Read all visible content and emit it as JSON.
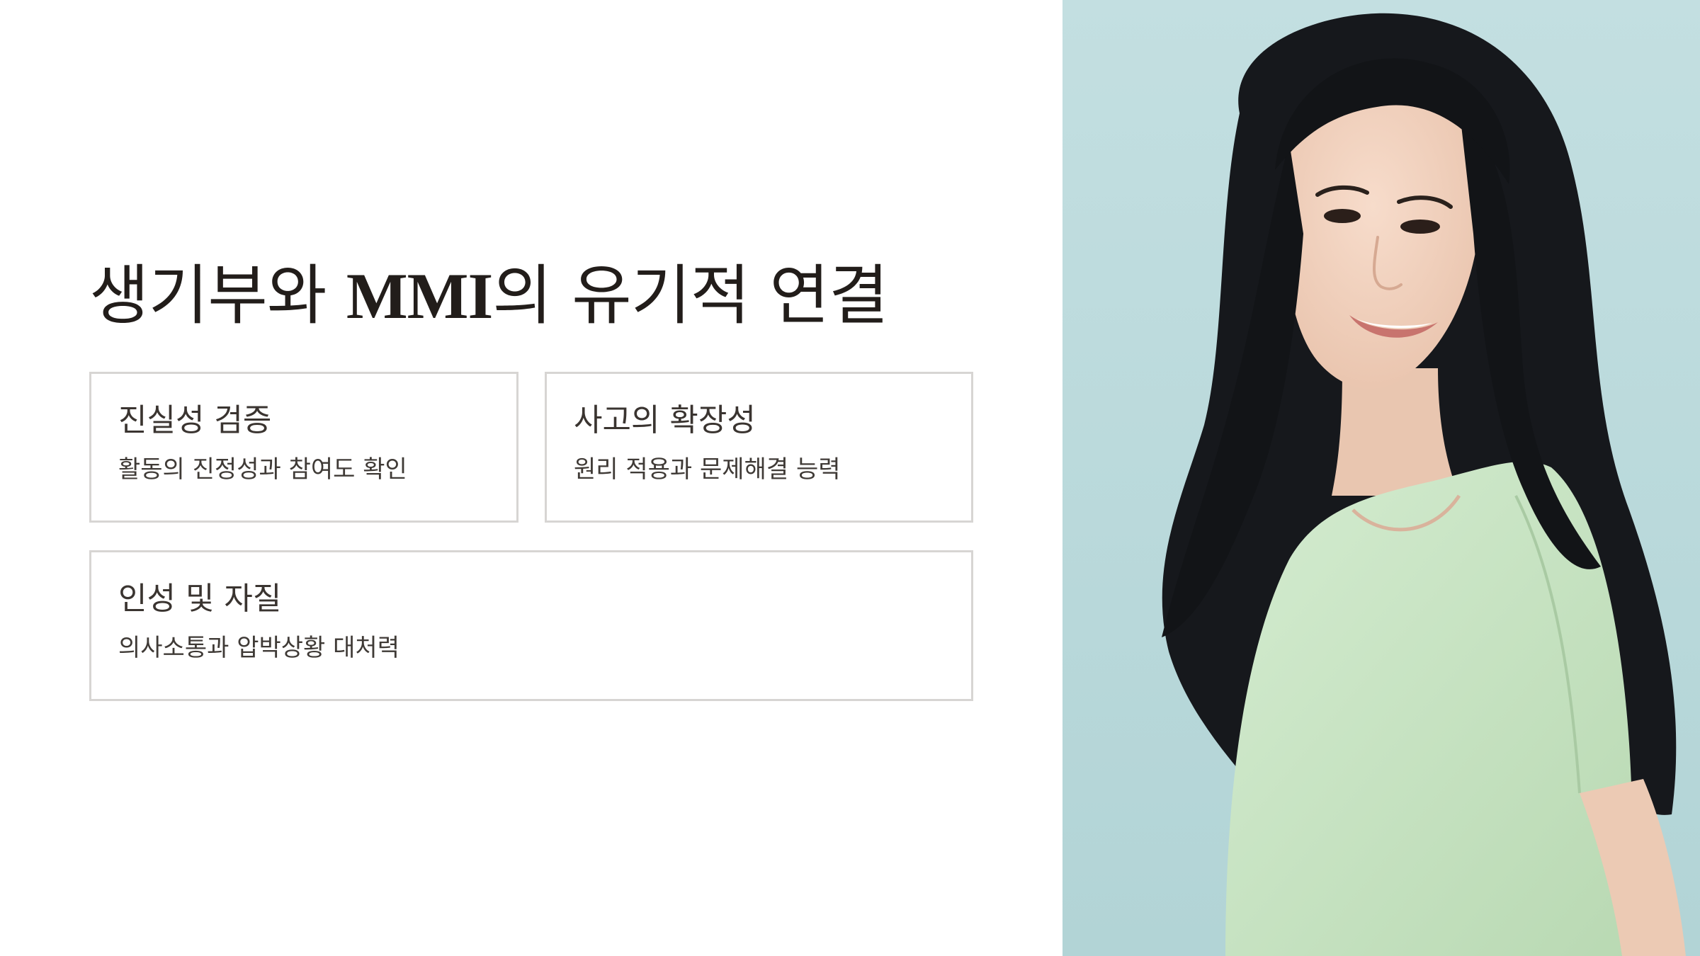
{
  "slide": {
    "title_prefix": "생기부와 ",
    "title_latin": "MMI",
    "title_suffix": "의 유기적 연결",
    "cards": [
      {
        "title": "진실성 검증",
        "description": "활동의 진정성과 참여도 확인"
      },
      {
        "title": "사고의 확장성",
        "description": "원리 적용과 문제해결 능력"
      },
      {
        "title": "인성 및 자질",
        "description": "의사소통과 압박상황 대처력"
      }
    ]
  },
  "photo": {
    "subject": "smiling woman with long dark hair in a mint green top",
    "background_color": "#b9d9db",
    "top_color": "#c9e6c4",
    "hair_color": "#16181c",
    "skin_color": "#f2d4c0"
  }
}
